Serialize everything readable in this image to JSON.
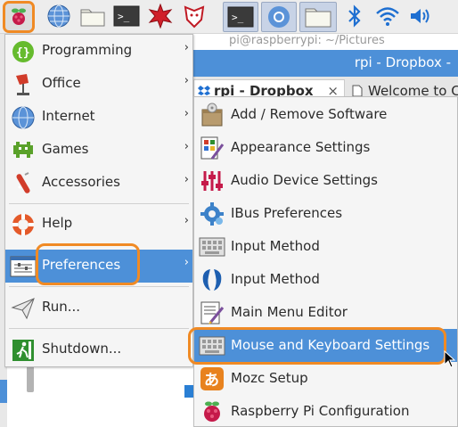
{
  "taskbar": {
    "icons": [
      "raspberry-pi-menu-icon",
      "web-browser-icon",
      "file-manager-icon",
      "terminal-icon",
      "mathematica-icon",
      "wolfram-icon",
      "terminal-window-icon",
      "chromium-window-icon",
      "folder-window-icon",
      "bluetooth-icon",
      "wifi-icon",
      "volume-icon"
    ]
  },
  "background": {
    "address_text": "pi@raspberrypi: ~/Pictures",
    "window_title": "rpi - Dropbox -",
    "tabs": [
      {
        "label": "rpi - Dropbox",
        "close": "×"
      },
      {
        "label": "Welcome to Cl"
      }
    ]
  },
  "main_menu": {
    "items": [
      {
        "label": "Programming",
        "icon": "programming-icon",
        "arrow": "›"
      },
      {
        "label": "Office",
        "icon": "office-icon",
        "arrow": "›"
      },
      {
        "label": "Internet",
        "icon": "internet-icon",
        "arrow": "›"
      },
      {
        "label": "Games",
        "icon": "games-icon",
        "arrow": "›"
      },
      {
        "label": "Accessories",
        "icon": "accessories-icon",
        "arrow": "›"
      },
      {
        "label": "Help",
        "icon": "help-icon",
        "arrow": "›"
      },
      {
        "label": "Preferences",
        "icon": "preferences-icon",
        "arrow": "›"
      },
      {
        "label": "Run...",
        "icon": "run-icon"
      },
      {
        "label": "Shutdown...",
        "icon": "shutdown-icon"
      }
    ]
  },
  "preferences_menu": {
    "items": [
      {
        "label": "Add / Remove Software",
        "icon": "add-remove-software-icon"
      },
      {
        "label": "Appearance Settings",
        "icon": "appearance-settings-icon"
      },
      {
        "label": "Audio Device Settings",
        "icon": "audio-device-settings-icon"
      },
      {
        "label": "IBus Preferences",
        "icon": "ibus-preferences-icon"
      },
      {
        "label": "Input Method",
        "icon": "keyboard-input-method-icon"
      },
      {
        "label": "Input Method",
        "icon": "fcitx-input-method-icon"
      },
      {
        "label": "Main Menu Editor",
        "icon": "main-menu-editor-icon"
      },
      {
        "label": "Mouse and Keyboard Settings",
        "icon": "mouse-keyboard-settings-icon"
      },
      {
        "label": "Mozc Setup",
        "icon": "mozc-setup-icon"
      },
      {
        "label": "Raspberry Pi Configuration",
        "icon": "raspberry-pi-configuration-icon"
      }
    ]
  },
  "colors": {
    "highlight": "#4d90d8",
    "annotation": "#f08a24",
    "menu_bg": "#f5f5f5"
  }
}
